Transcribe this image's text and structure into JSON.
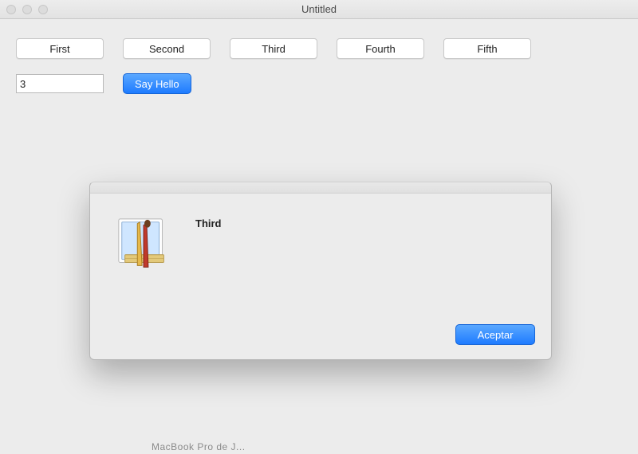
{
  "window": {
    "title": "Untitled"
  },
  "toolbar": {
    "buttons": [
      "First",
      "Second",
      "Third",
      "Fourth",
      "Fifth"
    ],
    "input_value": "3",
    "say_hello_label": "Say Hello"
  },
  "dialog": {
    "message": "Third",
    "accept_label": "Aceptar",
    "icon": "application-icon"
  },
  "background_peek": "MacBook Pro de J..."
}
